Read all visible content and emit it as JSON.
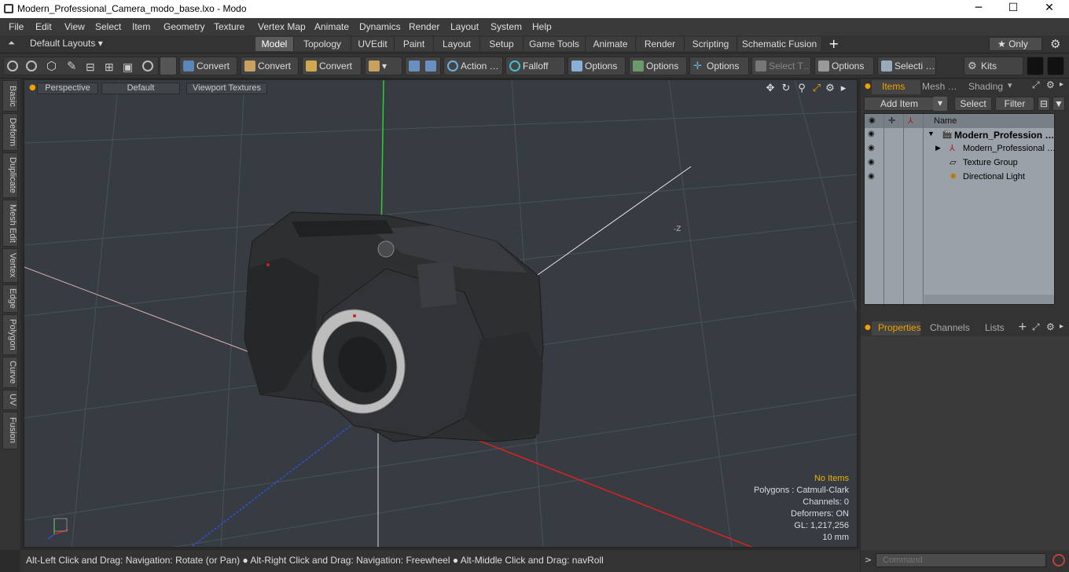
{
  "window": {
    "title": "Modern_Professional_Camera_modo_base.lxo - Modo",
    "minimize": "─",
    "maximize": "☐",
    "close": "✕"
  },
  "menu": [
    "File",
    "Edit",
    "View",
    "Select",
    "Item",
    "Geometry",
    "Texture",
    "Vertex Map",
    "Animate",
    "Dynamics",
    "Render",
    "Layout",
    "System",
    "Help"
  ],
  "layout_selector": "Default Layouts ▾",
  "layout_tabs": [
    "Model",
    "Topology",
    "UVEdit",
    "Paint",
    "Layout",
    "Setup",
    "Game Tools",
    "Animate",
    "Render",
    "Scripting",
    "Schematic Fusion"
  ],
  "active_layout_tab": "Model",
  "only_label": "★  Only",
  "toolbar": {
    "convert1": "Convert",
    "convert2": "Convert",
    "convert3": "Convert",
    "action": "Action …",
    "falloff": "Falloff",
    "options1": "Options",
    "options2": "Options",
    "options3": "Options",
    "select_t": "Select T…",
    "options4": "Options",
    "selecti": "Selecti …",
    "kits": "Kits"
  },
  "left_tabs": [
    "Basic",
    "Deform",
    "Duplicate",
    "Mesh Edit",
    "Vertex",
    "Edge",
    "Polygon",
    "Curve",
    "UV",
    "Fusion"
  ],
  "viewport": {
    "view": "Perspective",
    "style": "Default",
    "textures": "Viewport Textures",
    "axis_label": "-Z",
    "stats": {
      "items": "No Items",
      "polygons": "Polygons : Catmull-Clark",
      "channels": "Channels: 0",
      "deformers": "Deformers: ON",
      "gl": "GL: 1,217,256",
      "scale": "10 mm"
    }
  },
  "status_text": "Alt-Left Click and Drag: Navigation: Rotate (or Pan) ● Alt-Right Click and Drag: Navigation: Freewheel ● Alt-Middle Click and Drag: navRoll",
  "right_panel": {
    "tabs": [
      "Items",
      "Mesh …",
      "Shading"
    ],
    "add_item": "Add Item",
    "select": "Select",
    "filter": "Filter",
    "name_header": "Name",
    "items": [
      {
        "label": "Modern_Profession …",
        "bold": true
      },
      {
        "label": "Modern_Professional …",
        "bold": false
      },
      {
        "label": "Texture Group",
        "bold": false
      },
      {
        "label": "Directional Light",
        "bold": false
      }
    ],
    "bottom_tabs": [
      "Properties",
      "Channels",
      "Lists"
    ]
  },
  "command": {
    "placeholder": "Command"
  }
}
